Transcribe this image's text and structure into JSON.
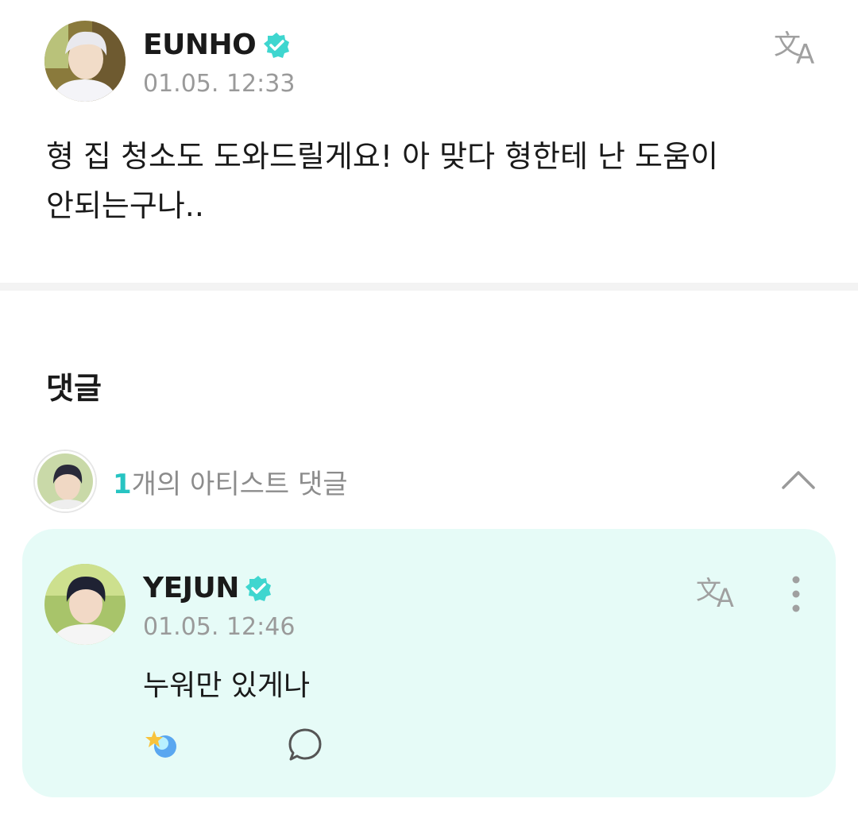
{
  "post": {
    "author": "EUNHO",
    "timestamp": "01.05. 12:33",
    "body_line1": "형 집 청소도 도와드릴게요! 아 맞다 형한테 난 도움이",
    "body_line2": "안되는구나.."
  },
  "comments": {
    "title": "댓글",
    "artist_summary": {
      "count": "1",
      "label": "개의 아티스트 댓글"
    },
    "items": [
      {
        "author": "YEJUN",
        "timestamp": "01.05. 12:46",
        "body": "누워만 있게나"
      }
    ]
  },
  "colors": {
    "accent": "#27c4c2",
    "card_background": "#e6fbf7",
    "muted_text": "#9a9a9a"
  },
  "icons": [
    "verified-badge-icon",
    "translate-icon",
    "chevron-up-icon",
    "more-vertical-icon",
    "reaction-icon",
    "reply-bubble-icon"
  ]
}
